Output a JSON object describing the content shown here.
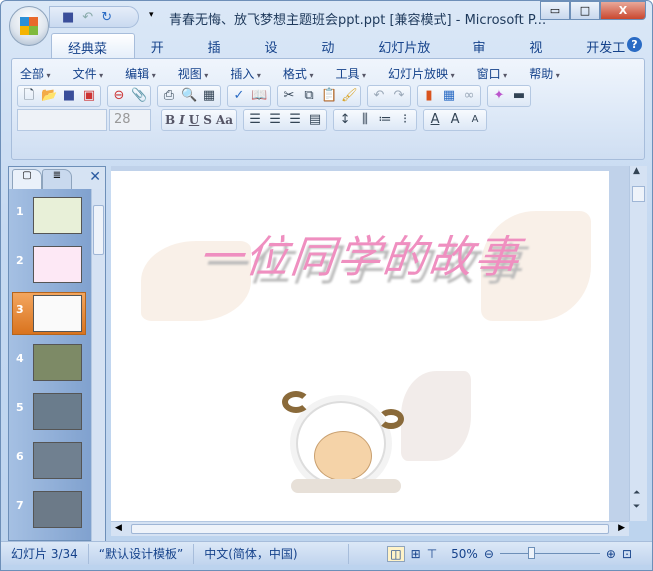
{
  "window": {
    "title": "青春无悔、放飞梦想主题班会ppt.ppt [兼容模式] - Microsoft P...",
    "minimize": "▭",
    "maximize": "□",
    "close": "X"
  },
  "tabs": [
    "经典菜单",
    "开始",
    "插入",
    "设计",
    "动画",
    "幻灯片放映",
    "审阅",
    "视图",
    "开发工具"
  ],
  "help": "?",
  "menu": [
    "全部",
    "文件",
    "编辑",
    "视图",
    "插入",
    "格式",
    "工具",
    "幻灯片放映",
    "窗口",
    "帮助"
  ],
  "font": {
    "name": "",
    "size": "28"
  },
  "format_buttons": [
    "B",
    "I",
    "U",
    "S",
    "Aa"
  ],
  "slides": {
    "numbers": [
      "1",
      "2",
      "3",
      "4",
      "5",
      "6",
      "7"
    ],
    "selected": "3"
  },
  "slide": {
    "title": "一位同学的故事"
  },
  "status": {
    "slide": "幻灯片 3/34",
    "template": "“默认设计模板”",
    "language": "中文(简体，中国)",
    "zoom": "50%"
  }
}
